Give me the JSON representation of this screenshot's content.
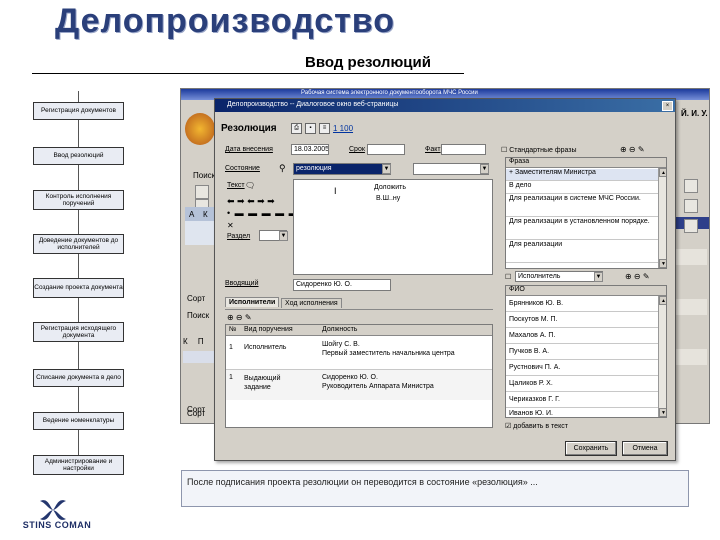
{
  "slide": {
    "main_title": "Делопроизводство",
    "subtitle": "Ввод резолюций",
    "caption": "После подписания проекта резолюции он переводится в состояние «резолюция» ...",
    "logo_text": "STINS COMAN"
  },
  "steps": [
    "Регистрация документов",
    "Ввод резолюций",
    "Контроль исполнения поручений",
    "Доведение документов до исполнителей",
    "Создание проекта документа",
    "Регистрация исходящего документа",
    "Списание документа в дело",
    "Ведение номенклатуры",
    "Администрирование и настройки"
  ],
  "bg_app": {
    "title": "Рабочая система электронного документооборота МЧС России",
    "user": "Й. И. У.",
    "side_labels": [
      "Поиск",
      "Поиск",
      "К",
      "П"
    ],
    "row_labels": [
      "А",
      "К",
      "Сорт",
      "Сорт",
      "Сорт"
    ]
  },
  "dialog": {
    "title": "Делопроизводство -- Диалоговое окно веб-страницы",
    "close": "×",
    "header_label": "Резолюция",
    "doc_num": "1 100",
    "date_label": "Дата внесения",
    "date_value": "18.03.2005",
    "term_label": "Срок",
    "fact_label": "Факт",
    "state_label": "Состояние",
    "state_value": "резолюция",
    "text_label": "Текст",
    "section_label": "Раздел",
    "text_body_line1": "Доложить",
    "text_body_line2": "В.Ш..ну",
    "author_label": "Вводящий",
    "author_value": "Сидоренко Ю. О.",
    "tabs": [
      "Исполнители",
      "Ход исполнения"
    ],
    "exec_headers": [
      "№",
      "Вид поручения",
      "Должность"
    ],
    "exec_rows": [
      {
        "num": "1",
        "kind": "Исполнитель",
        "person": "Шойгу С. В.",
        "position": "Первый заместитель начальника центра"
      },
      {
        "num": "1",
        "kind": "Выдающий задание",
        "person": "Сидоренко Ю. О.",
        "position": "Руководитель Аппарата Министра"
      }
    ],
    "phrases_checkbox": "Стандартные фразы",
    "phrase_header": "Фраза",
    "phrases": [
      "+ Заместителям Министра",
      "В дело",
      "Для реализации в системе МЧС России.",
      "Для реализации в установленном порядке.",
      "Для реализации"
    ],
    "executor_filter": "Исполнитель",
    "fio_header": "ФИО",
    "people": [
      "Брянников Ю. В.",
      "Поскутов М. П.",
      "Махалов А. П.",
      "Пучков В. А.",
      "Рустнович П. А.",
      "Цаликов Р. Х.",
      "Чериказков Г. Г.",
      "Иванов Ю. И."
    ],
    "add_to_text": "добавить в текст",
    "save_button": "Сохранить",
    "cancel_button": "Отмена"
  }
}
